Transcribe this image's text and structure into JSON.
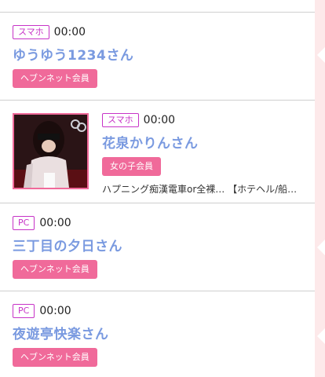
{
  "entries": [
    {
      "device": "スマホ",
      "time": "00:00",
      "name": "ゆうゆう1234さん",
      "member_type": "ヘブンネット会員"
    },
    {
      "device": "スマホ",
      "time": "00:00",
      "name": "花泉かりんさん",
      "member_type": "女の子会員",
      "comment": "ハプニング痴漢電車or全裸… 【ホテヘル/船…"
    },
    {
      "device": "PC",
      "time": "00:00",
      "name": "三丁目の夕日さん",
      "member_type": "ヘブンネット会員"
    },
    {
      "device": "PC",
      "time": "00:00",
      "name": "夜遊亭快楽さん",
      "member_type": "ヘブンネット会員"
    }
  ],
  "colors": {
    "device_badge": "#c733c7",
    "name": "#7a9ae0",
    "member_button": "#f06a9a",
    "side_strip": "#fde9ea"
  }
}
